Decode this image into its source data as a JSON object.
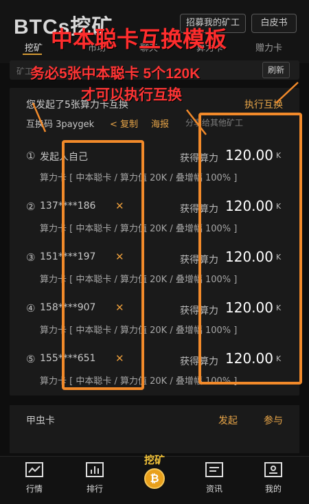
{
  "header": {
    "logo_text": "BTCs挖矿",
    "recruit_label": "招募我的矿工",
    "whitepaper_label": "白皮书",
    "nav_tabs": [
      "挖矿",
      "市场",
      "聊天",
      "算力卡",
      "赠力卡"
    ]
  },
  "search": {
    "hint": "矿工",
    "refresh_label": "刷新"
  },
  "card": {
    "title": "您发起了5张算力卡互换",
    "execute_label": "执行互换",
    "code_label": "互换码 3paygek",
    "copy_label": "< 复制",
    "poster_label": "海报",
    "share_hint": "分享给其他矿工",
    "rows": [
      {
        "idx": "①",
        "name": "发起人自己",
        "x": "",
        "gain": "获得算力",
        "value": "120.00",
        "unit": "K",
        "desc": "算力卡 [ 中本聪卡 / 算力值 20K / 叠增幅 100% ]"
      },
      {
        "idx": "②",
        "name": "137****186",
        "x": "✕",
        "gain": "获得算力",
        "value": "120.00",
        "unit": "K",
        "desc": "算力卡 [ 中本聪卡 / 算力值 20K / 叠增幅 100% ]"
      },
      {
        "idx": "③",
        "name": "151****197",
        "x": "✕",
        "gain": "获得算力",
        "value": "120.00",
        "unit": "K",
        "desc": "算力卡 [ 中本聪卡 / 算力值 20K / 叠增幅 100% ]"
      },
      {
        "idx": "④",
        "name": "158****907",
        "x": "✕",
        "gain": "获得算力",
        "value": "120.00",
        "unit": "K",
        "desc": "算力卡 [ 中本聪卡 / 算力值 20K / 叠增幅 100% ]"
      },
      {
        "idx": "⑤",
        "name": "155****651",
        "x": "✕",
        "gain": "获得算力",
        "value": "120.00",
        "unit": "K",
        "desc": "算力卡 [ 中本聪卡 / 算力值 20K / 叠增幅 100% ]"
      }
    ]
  },
  "card2": {
    "title": "甲虫卡",
    "start_label": "发起",
    "join_label": "参与"
  },
  "tabbar": {
    "market_label": "行情",
    "rank_label": "排行",
    "mine_label": "挖矿",
    "news_label": "资讯",
    "me_label": "我的"
  },
  "overlay": {
    "title": "中本聪卡互换模板",
    "line1": "务必5张中本聪卡 5个120K",
    "line2": "才可以执行互换",
    "annotation_color": "#ff2d2d",
    "box_color": "#f28a2a"
  },
  "colors": {
    "accent": "#e8a548",
    "background": "#0e0e0e"
  }
}
